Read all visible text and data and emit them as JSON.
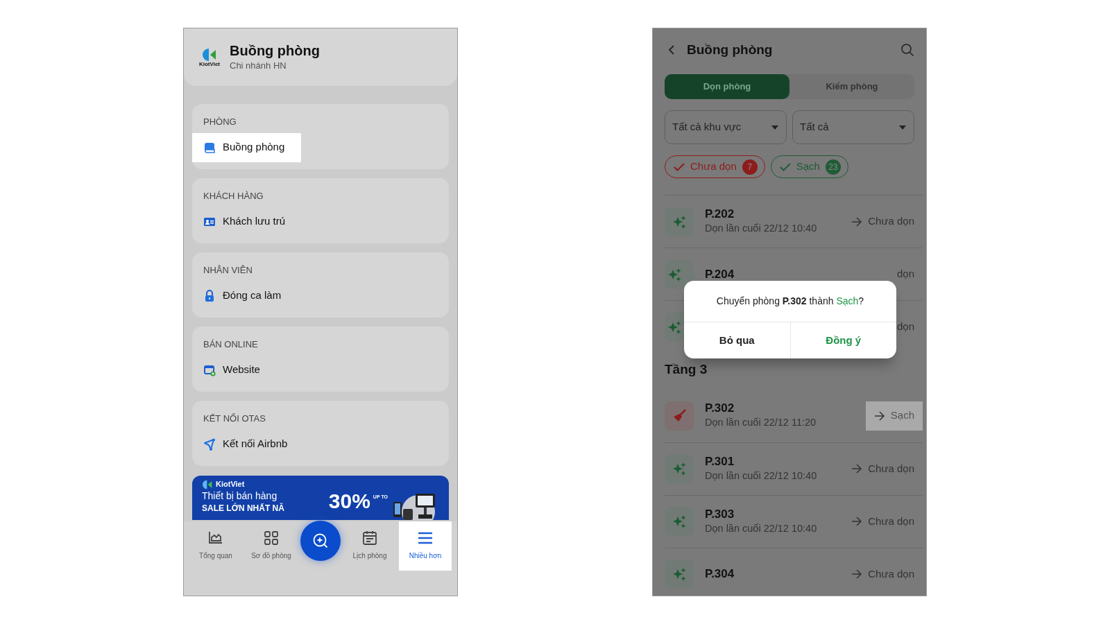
{
  "left_screen": {
    "header": {
      "logo_text": "KiotViet",
      "title": "Buồng phòng",
      "subtitle": "Chi nhánh HN"
    },
    "sections": [
      {
        "label": "PHÒNG",
        "items": [
          {
            "label": "Buồng phòng",
            "selected": true
          }
        ]
      },
      {
        "label": "KHÁCH HÀNG",
        "items": [
          {
            "label": "Khách lưu trú",
            "selected": false
          }
        ]
      },
      {
        "label": "NHÂN VIÊN",
        "items": [
          {
            "label": "Đóng ca làm",
            "selected": false
          }
        ]
      },
      {
        "label": "BÁN ONLINE",
        "items": [
          {
            "label": "Website",
            "selected": false
          }
        ]
      },
      {
        "label": "KẾT NỐI OTAS",
        "items": [
          {
            "label": "Kết nối Airbnb",
            "selected": false
          }
        ]
      }
    ],
    "banner": {
      "brand": "KiotViet",
      "headline": "Thiết bị bán hàng",
      "subline": "SALE LỚN NHẤT NĂ",
      "discount": "30%",
      "discount_note": "UP TO"
    },
    "bottom_nav": [
      {
        "label": "Tổng quan",
        "selected": false
      },
      {
        "label": "Sơ đồ phòng",
        "selected": false
      },
      {
        "label": "Lịch phòng",
        "selected": false
      },
      {
        "label": "Nhiều hơn",
        "selected": true
      }
    ]
  },
  "right_screen": {
    "title": "Buồng phòng",
    "tabs": [
      {
        "label": "Dọn phòng",
        "selected": true
      },
      {
        "label": "Kiểm phòng",
        "selected": false
      }
    ],
    "filters": [
      {
        "value": "Tất cả khu vực"
      },
      {
        "value": "Tất cả"
      }
    ],
    "chips": [
      {
        "label": "Chưa dọn",
        "count": "7",
        "checked": true,
        "color": "#8e1c1c"
      },
      {
        "label": "Sạch",
        "count": "23",
        "checked": true,
        "color": "#1f5c36"
      }
    ],
    "rooms": [
      {
        "kind": "clean",
        "name": "P.202",
        "last_cleaned": "Dọn lần cuối 22/12 10:40",
        "action": "Chưa dọn",
        "highlighted": false
      },
      {
        "kind": "covered",
        "name": "P.204",
        "action": "dọn"
      },
      {
        "kind": "covered",
        "action": "dọn"
      }
    ],
    "floor_heading": "Tầng 3",
    "floor_rooms": [
      {
        "kind": "dirty",
        "name": "P.302",
        "last_cleaned": "Dọn lần cuối 22/12 11:20",
        "action": "Sạch",
        "highlighted": true
      },
      {
        "kind": "clean",
        "name": "P.301",
        "last_cleaned": "Dọn lần cuối 22/12 10:40",
        "action": "Chưa dọn",
        "highlighted": false
      },
      {
        "kind": "clean",
        "name": "P.303",
        "last_cleaned": "Dọn lần cuối 22/12 10:40",
        "action": "Chưa dọn",
        "highlighted": false
      },
      {
        "kind": "clean",
        "name": "P.304",
        "action": "Chưa dọn",
        "highlighted": false
      }
    ],
    "dialog": {
      "message": "Chuyển phòng **P.302** thành *Sạch*?",
      "buttons": [
        {
          "label": "Bỏ qua",
          "kind": "cancel"
        },
        {
          "label": "Đồng ý",
          "kind": "confirm"
        }
      ]
    }
  }
}
